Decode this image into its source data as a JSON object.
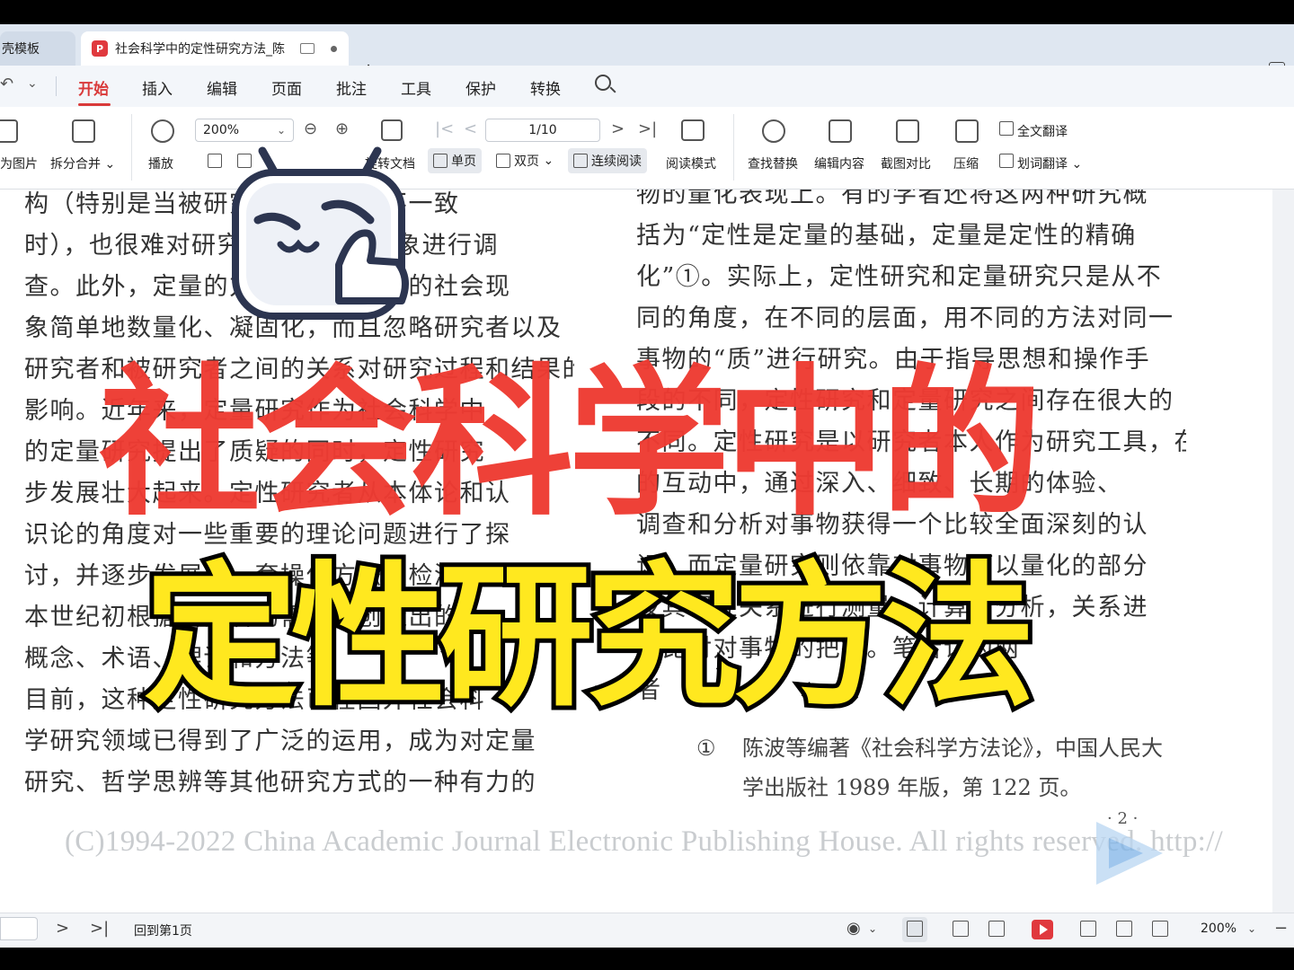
{
  "tabs": {
    "inactive_label": "壳模板",
    "active_label": "社会科学中的定性研究方法_陈",
    "active_icon": "pdf-icon",
    "new_tab": "+"
  },
  "menu": {
    "items": [
      "开始",
      "插入",
      "编辑",
      "页面",
      "批注",
      "工具",
      "保护",
      "转换"
    ],
    "active": "开始",
    "accent_color": "#d93a3a"
  },
  "toolbar": {
    "to_image": "为图片",
    "split_merge": "拆分合并",
    "play": "播放",
    "zoom": "200%",
    "rotate": "旋转文档",
    "single_page": "单页",
    "double_page": "双页",
    "continuous": "连续阅读",
    "read_mode": "阅读模式",
    "page_indicator": "1/10",
    "find_replace": "查找替换",
    "edit_content": "编辑内容",
    "screenshot_compare": "截图对比",
    "compress": "压缩",
    "full_translate": "全文翻译",
    "word_translate": "划词翻译"
  },
  "document": {
    "left_column": [
      "构（特别是当被研究者与研究者不一致",
      "时），也很难对研究者所研究的现象进行调",
      "查。此外，定量的方法往往将流动的社会现",
      "象简单地数量化、凝固化，而且忽略研究者以及",
      "研究者和被研究者之间的关系对研究过程和结果的",
      "影响。近年来，定量研究作为社会科学中",
      "的定量研究提出了质疑的同时，定性研究",
      "步发展壮大起来。定性研究者从本体论和认",
      "识论的角度对一些重要的理论问题进行了探",
      "讨，并逐步发展出一套操作方法和检测手段。自",
      "本世纪初根据研究者的需要而创造出的",
      "概念、术语、理论和方法等",
      "目前，这种定性研究方法已在国外社会科",
      "学研究领域已得到了广泛的运用，成为对定量",
      "研究、哲学思辨等其他研究方式的一种有力的"
    ],
    "right_column": [
      "物的量化表现上。有的学者还将这两种研究概",
      "括为“定性是定量的基础，定量是定性的精确",
      "化”①。实际上，定性研究和定量研究只是从不",
      "同的角度，在不同的层面，用不同的方法对同一",
      "事物的“质”进行研究。由于指导思想和操作手",
      "段的不同，定性研究和定量研究之间存在很大的",
      "不同。定性研究是以研究者本人作为研究工具，在",
      "的互动中，通过深入、细致、长期的体验、",
      "调查和分析对事物获得一个比较全面深刻的认",
      "识；而定量研究则依靠对事物可以量化的部分",
      "及其相互关系进行测量、计算和分析，关系进",
      "行比对对事物的把握。笔者认为两",
      "者"
    ],
    "footnote_mark": "①",
    "footnote_line1": "陈波等编著《社会科学方法论》，中国人民大",
    "footnote_line2": "学出版社 1989 年版，第 122 页。",
    "page_number": "· 2 ·",
    "copyright": "(C)1994-2022 China Academic Journal Electronic Publishing House. All rights reserved.    http://"
  },
  "overlay": {
    "title_red": "社会科学中的",
    "title_yellow": "定性研究方法",
    "red_color": "#ee3b32",
    "yellow_color": "#ffe81f"
  },
  "statusbar": {
    "back_to_first": "回到第1页",
    "zoom": "200%"
  }
}
